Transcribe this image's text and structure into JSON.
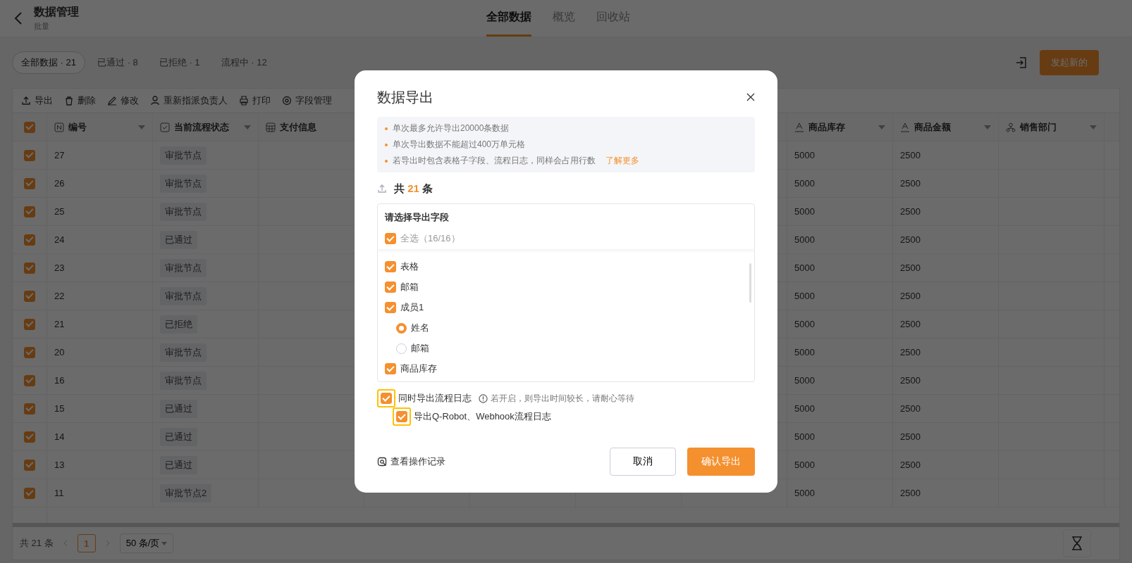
{
  "header": {
    "title": "数据管理",
    "subtitle": "批量",
    "tabs": [
      {
        "label": "全部数据",
        "selected": true
      },
      {
        "label": "概览",
        "selected": false
      },
      {
        "label": "回收站",
        "selected": false
      }
    ]
  },
  "filters": [
    {
      "label": "全部数据 · 21",
      "selected": true
    },
    {
      "label": "已通过 · 8",
      "selected": false
    },
    {
      "label": "已拒绝 · 1",
      "selected": false
    },
    {
      "label": "流程中 · 12",
      "selected": false
    }
  ],
  "new_button": "发起新的",
  "toolbar": [
    "导出",
    "删除",
    "修改",
    "重新指派负责人",
    "打印",
    "字段管理"
  ],
  "table": {
    "header_checked": true,
    "columns": [
      {
        "label": "编号"
      },
      {
        "label": "当前流程状态"
      },
      {
        "label": "支付信息"
      },
      {
        "label": "商品库存"
      },
      {
        "label": "商品金额"
      },
      {
        "label": "销售部门"
      }
    ],
    "rows": [
      {
        "checked": true,
        "id": "27",
        "status": "审批节点",
        "stock": "5000",
        "amount": "2500"
      },
      {
        "checked": true,
        "id": "26",
        "status": "审批节点",
        "stock": "5000",
        "amount": "2500"
      },
      {
        "checked": true,
        "id": "25",
        "status": "审批节点",
        "stock": "5000",
        "amount": "2500"
      },
      {
        "checked": true,
        "id": "24",
        "status": "已通过",
        "stock": "5000",
        "amount": "2500"
      },
      {
        "checked": true,
        "id": "23",
        "status": "审批节点",
        "stock": "5000",
        "amount": "2500"
      },
      {
        "checked": true,
        "id": "22",
        "status": "审批节点",
        "stock": "5000",
        "amount": "2500"
      },
      {
        "checked": true,
        "id": "21",
        "status": "已拒绝",
        "stock": "5000",
        "amount": "2500"
      },
      {
        "checked": true,
        "id": "20",
        "status": "审批节点",
        "stock": "5000",
        "amount": "2500"
      },
      {
        "checked": true,
        "id": "16",
        "status": "审批节点",
        "stock": "5000",
        "amount": "2500"
      },
      {
        "checked": true,
        "id": "15",
        "status": "已通过",
        "stock": "5000",
        "amount": "2500"
      },
      {
        "checked": true,
        "id": "14",
        "status": "已通过",
        "stock": "5000",
        "amount": "2500"
      },
      {
        "checked": true,
        "id": "13",
        "status": "已通过",
        "stock": "5000",
        "amount": "2500"
      },
      {
        "checked": true,
        "id": "11",
        "status": "审批节点2",
        "stock": "5000",
        "amount": "2500"
      }
    ]
  },
  "pagination": {
    "total": "共 21 条",
    "pages": [
      {
        "label": "1",
        "selected": true
      }
    ],
    "page_size": "50 条/页"
  },
  "dialog": {
    "title": "数据导出",
    "notes": [
      "单次最多允许导出20000条数据",
      "单次导出数据不能超过400万单元格",
      "若导出时包含表格子字段、流程日志，同样会占用行数"
    ],
    "learn_more": "了解更多",
    "count_prefix": "共",
    "count": "21",
    "count_suffix": "条",
    "fields_title": "请选择导出字段",
    "select_all": {
      "label": "全选（16/16）",
      "checked": true
    },
    "fields": [
      {
        "label": "表格",
        "checked": true
      },
      {
        "label": "邮箱",
        "checked": true
      },
      {
        "label": "成员1",
        "checked": true,
        "children": [
          {
            "label": "姓名",
            "selected": true
          },
          {
            "label": "邮箱",
            "selected": false
          }
        ]
      },
      {
        "label": "商品库存",
        "checked": true
      }
    ],
    "log_option": {
      "label": "同时导出流程日志",
      "checked": true,
      "highlighted": true,
      "hint": "若开启，则导出时间较长，请耐心等待"
    },
    "robot_option": {
      "label": "导出Q-Robot、Webhook流程日志",
      "checked": true,
      "highlighted": true
    },
    "history_link": "查看操作记录",
    "cancel": "取消",
    "confirm": "确认导出"
  }
}
